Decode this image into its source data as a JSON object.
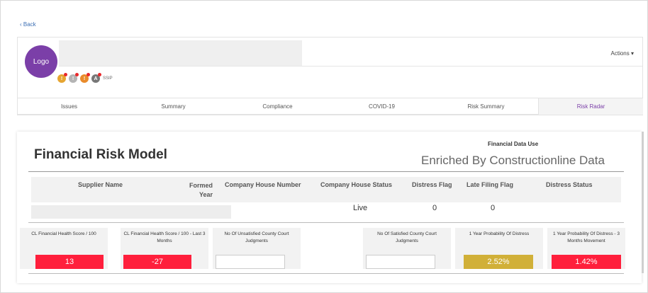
{
  "nav": {
    "back_label": "‹ Back"
  },
  "header": {
    "logo_label": "Logo",
    "actions_label": "Actions ▾",
    "badges": [
      {
        "icon": "finance-icon",
        "letter": "!"
      },
      {
        "icon": "document-icon",
        "letter": "!"
      },
      {
        "icon": "finance-icon",
        "letter": "!"
      },
      {
        "icon": "accreditation-icon",
        "letter": "A"
      }
    ],
    "badge_text": "SSIP"
  },
  "tabs": [
    {
      "label": "Issues"
    },
    {
      "label": "Summary"
    },
    {
      "label": "Compliance"
    },
    {
      "label": "COVID-19"
    },
    {
      "label": "Risk Summary"
    },
    {
      "label": "Risk Radar"
    }
  ],
  "active_tab": "Risk Radar",
  "panel": {
    "title": "Financial Risk Model",
    "financial_data_use_label": "Financial Data Use",
    "financial_data_use_value": "Enriched By Constructionline Data"
  },
  "info_table": {
    "headers": {
      "supplier_name": "Supplier Name",
      "formed_year": "Formed Year",
      "company_house_number": "Company House Number",
      "company_house_status": "Company House Status",
      "distress_flag": "Distress Flag",
      "late_filing_flag": "Late Filing Flag",
      "distress_status": "Distress Status"
    },
    "row": {
      "supplier_name": "",
      "formed_year": "",
      "company_house_number": "",
      "company_house_status": "Live",
      "distress_flag": "0",
      "late_filing_flag": "0",
      "distress_status": ""
    }
  },
  "metrics": [
    {
      "label": "CL Financial Health Score / 100",
      "value": "13",
      "color": "#ff1f3c"
    },
    {
      "label": "CL Financial Health Score / 100 - Last 3 Months",
      "value": "-27",
      "color": "#ff1f3c"
    },
    {
      "label": "No Of Unsatisfied County Court Judgments",
      "value": "",
      "color": ""
    },
    {
      "label": "No Of Satisfied County Court Judgments",
      "value": "",
      "color": ""
    },
    {
      "label": "1 Year Probability Of Distress",
      "value": "2.52%",
      "color": "#d1b038"
    },
    {
      "label": "1 Year Probability Of Distress - 3 Months Movement",
      "value": "1.42%",
      "color": "#ff1f3c"
    }
  ],
  "colors": {
    "brand": "#7b3fa8",
    "danger": "#ff1f3c",
    "warning": "#d1b038",
    "link": "#3c6fb4"
  }
}
